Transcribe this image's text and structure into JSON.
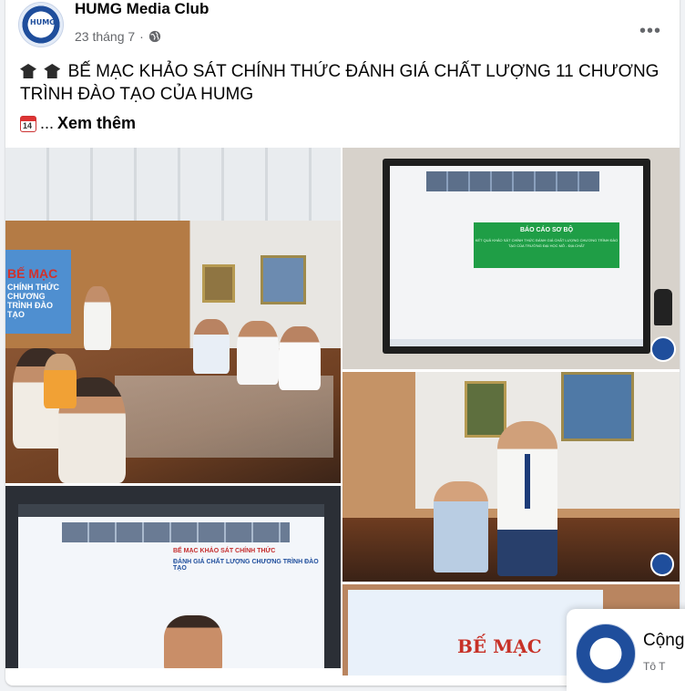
{
  "post": {
    "page_name": "HUMG Media Club",
    "date": "23 tháng 7",
    "separator": "·",
    "text": "BẾ MẠC KHẢO SÁT CHÍNH THỨC ĐÁNH GIÁ CHẤT LƯỢNG 11 CHƯƠNG TRÌNH ĐÀO TẠO CỦA HUMG",
    "ellipsis": "...",
    "see_more": "Xem thêm",
    "more_options": "•••",
    "calendar_day": "14"
  },
  "photos": {
    "screen1_title": "BẾ MẠC",
    "screen1_sub": "CHÍNH THỨC\nCHƯƠNG TRÌNH ĐÀO TẠO",
    "report_title": "BÁO CÁO SƠ BỘ",
    "report_sub": "KẾT QUẢ KHẢO SÁT CHÍNH THỨC\nĐÁNH GIÁ CHẤT LƯỢNG CHƯƠNG TRÌNH ĐÀO TẠO\nCỦA TRƯỜNG ĐẠI HỌC MỎ - ĐỊA CHẤT",
    "zoom_line1": "BẾ MẠC KHẢO SÁT CHÍNH THỨC",
    "zoom_line2": "ĐÁNH GIÁ CHẤT LƯỢNG CHƯƠNG TRÌNH ĐÀO TẠO",
    "banner_title": "BẾ MẠC"
  },
  "popup": {
    "title": "Cộng",
    "subtitle": "Tô T"
  },
  "colors": {
    "background": "#f0f2f5",
    "card": "#ffffff",
    "secondary_text": "#65676b",
    "brand_blue": "#1f4e9c"
  },
  "icons": [
    "globe-icon",
    "more-options-icon",
    "graduation-cap-icon",
    "calendar-icon"
  ]
}
